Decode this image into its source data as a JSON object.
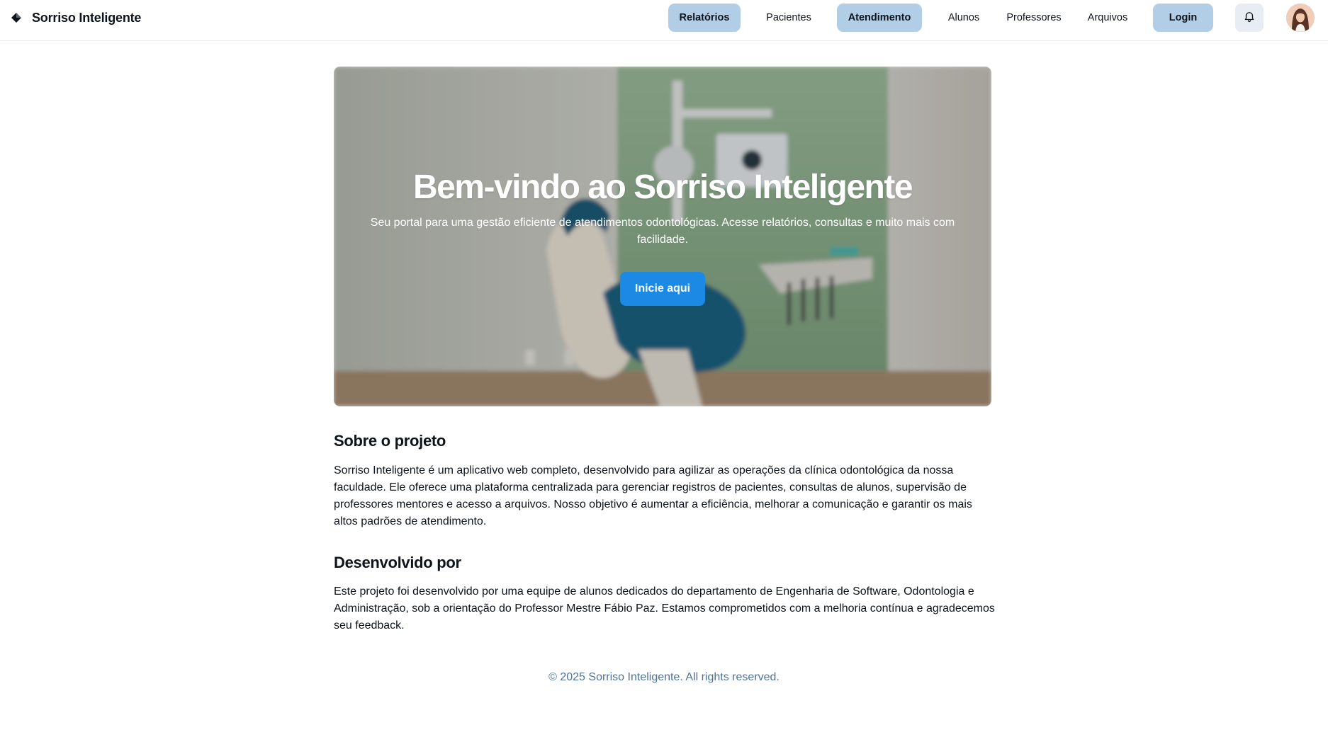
{
  "header": {
    "brand": "Sorriso Inteligente",
    "nav": [
      {
        "label": "Relatórios",
        "active": true
      },
      {
        "label": "Pacientes",
        "active": false
      },
      {
        "label": "Atendimento",
        "active": true
      },
      {
        "label": "Alunos",
        "active": false
      },
      {
        "label": "Professores",
        "active": false
      },
      {
        "label": "Arquivos",
        "active": false
      },
      {
        "label": "Login",
        "active": true
      }
    ],
    "icons": {
      "brand": "diamond-logo-icon",
      "notifications": "bell-icon",
      "avatar": "user-avatar"
    }
  },
  "hero": {
    "title": "Bem-vindo ao Sorriso Inteligente",
    "subtitle": "Seu portal para uma gestão eficiente de atendimentos odontológicas. Acesse relatórios, consultas e muito mais com facilidade.",
    "button": "Inicie aqui"
  },
  "about": {
    "title": "Sobre o projeto",
    "text": "Sorriso Inteligente é um aplicativo web completo, desenvolvido para agilizar as operações da clínica odontológica da nossa faculdade. Ele oferece uma plataforma centralizada para gerenciar registros de pacientes, consultas de alunos, supervisão de professores mentores e acesso a arquivos. Nosso objetivo é aumentar a eficiência, melhorar a comunicação e garantir os mais altos padrões de atendimento."
  },
  "developed": {
    "title": "Desenvolvido por",
    "text": "Este projeto foi desenvolvido por uma equipe de alunos dedicados do departamento de Engenharia de Software, Odontologia e Administração, sob a orientação do Professor Mestre Fábio Paz. Estamos comprometidos com a melhoria contínua e agradecemos seu feedback."
  },
  "footer": {
    "text": "© 2025 Sorriso Inteligente. All rights reserved."
  },
  "colors": {
    "accent": "#1c8ae4",
    "nav_active_bg": "#b2cde6",
    "footer_text": "#4e7397",
    "bell_bg": "#e7edf3"
  }
}
